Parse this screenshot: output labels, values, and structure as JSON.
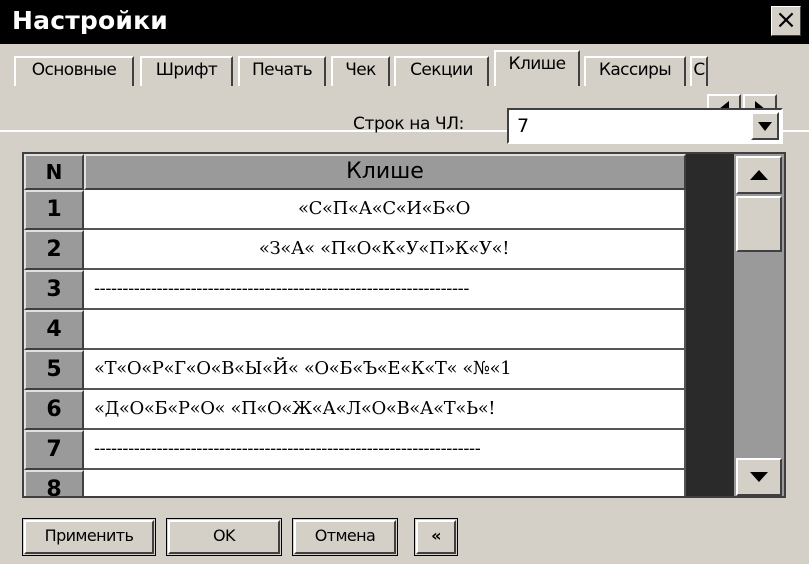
{
  "window": {
    "title": "Настройки",
    "close_label": "×"
  },
  "tabs": [
    {
      "label": "Основные"
    },
    {
      "label": "Шрифт"
    },
    {
      "label": "Печать"
    },
    {
      "label": "Чек"
    },
    {
      "label": "Секции"
    },
    {
      "label": "Клише",
      "active": true
    },
    {
      "label": "Кассиры"
    },
    {
      "label": "С"
    }
  ],
  "lines_per_cl": {
    "label": "Строк на ЧЛ:",
    "value": "7"
  },
  "table": {
    "headers": {
      "n": "N",
      "text": "Клише"
    },
    "rows": [
      {
        "n": "1",
        "text": "«С«П«А«С«И«Б«О",
        "align": "center"
      },
      {
        "n": "2",
        "text": "«З«А«  «П«О«К«У«П»К«У«!",
        "align": "center"
      },
      {
        "n": "3",
        "text": "------------------------------------------------------------------",
        "align": "left"
      },
      {
        "n": "4",
        "text": "",
        "align": "left"
      },
      {
        "n": "5",
        "text": "«Т«О«Р«Г«О«В«Ы«Й«  «О«Б«Ъ«Е«К«Т«  «№«1",
        "align": "left"
      },
      {
        "n": "6",
        "text": "«Д«О«Б«Р«О«  «П«О«Ж«А«Л«О«В«А«Т«Ь«!",
        "align": "left"
      },
      {
        "n": "7",
        "text": "--------------------------------------------------------------------",
        "align": "left"
      },
      {
        "n": "8",
        "text": "",
        "align": "left"
      }
    ]
  },
  "buttons": {
    "apply": "Применить",
    "ok": "OK",
    "cancel": "Отмена",
    "collapse": "«"
  }
}
